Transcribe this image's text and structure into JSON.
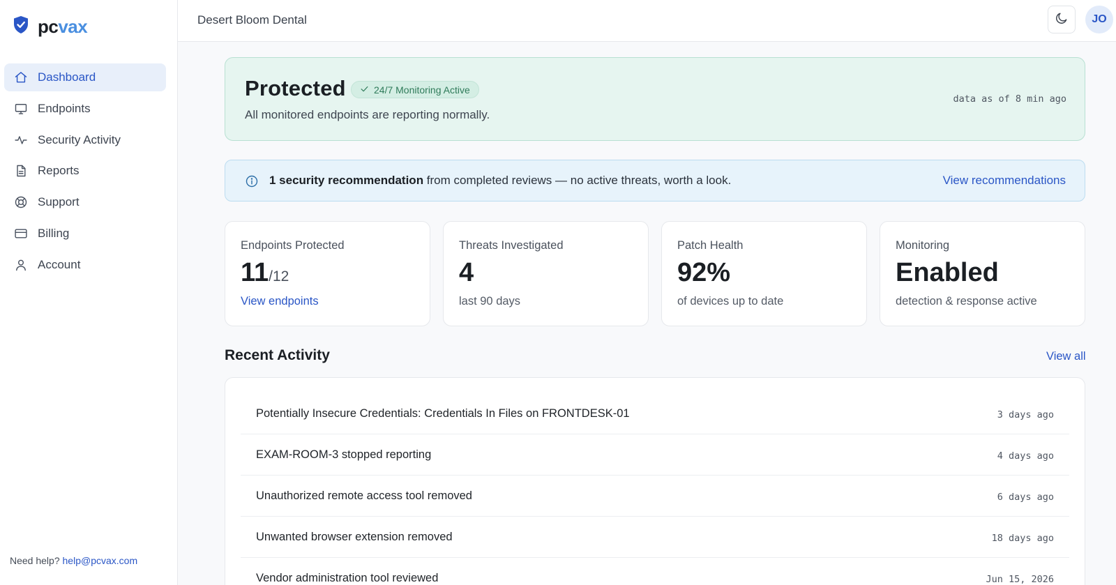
{
  "brand": {
    "name_part1": "pc",
    "name_part2": "vax",
    "logo_icon": "shield-check-icon",
    "accent_color": "#4a8fe0"
  },
  "sidebar": {
    "items": [
      {
        "label": "Dashboard",
        "icon": "home-icon",
        "active": true
      },
      {
        "label": "Endpoints",
        "icon": "monitor-icon"
      },
      {
        "label": "Security Activity",
        "icon": "activity-icon"
      },
      {
        "label": "Reports",
        "icon": "document-icon"
      },
      {
        "label": "Support",
        "icon": "lifebuoy-icon"
      },
      {
        "label": "Billing",
        "icon": "credit-card-icon"
      },
      {
        "label": "Account",
        "icon": "user-icon"
      }
    ],
    "help_prefix": "Need help?",
    "help_email": "help@pcvax.com"
  },
  "header": {
    "org_name": "Desert Bloom Dental",
    "theme_icon": "moon-icon",
    "avatar_initials": "JO"
  },
  "status": {
    "title": "Protected",
    "badge": "24/7 Monitoring Active",
    "subtitle": "All monitored endpoints are reporting normally.",
    "updated": "data as of 8 min ago"
  },
  "info_banner": {
    "bold": "1 security recommendation",
    "text": " from completed reviews — no active threats, worth a look.",
    "link": "View recommendations"
  },
  "cards": [
    {
      "label": "Endpoints Protected",
      "value": "11",
      "value_suffix": "/12",
      "link": "View endpoints"
    },
    {
      "label": "Threats Investigated",
      "value": "4",
      "sub": "last 90 days"
    },
    {
      "label": "Patch Health",
      "value": "92%",
      "sub": "of devices up to date"
    },
    {
      "label": "Monitoring",
      "value": "Enabled",
      "sub": "detection & response active"
    }
  ],
  "recent_activity": {
    "title": "Recent Activity",
    "view_all": "View all",
    "rows": [
      {
        "text": "Potentially Insecure Credentials: Credentials In Files on FRONTDESK-01",
        "time": "3 days ago"
      },
      {
        "text": "EXAM-ROOM-3 stopped reporting",
        "time": "4 days ago"
      },
      {
        "text": "Unauthorized remote access tool removed",
        "time": "6 days ago"
      },
      {
        "text": "Unwanted browser extension removed",
        "time": "18 days ago"
      },
      {
        "text": "Vendor administration tool reviewed",
        "time": "Jun 15, 2026"
      }
    ]
  }
}
